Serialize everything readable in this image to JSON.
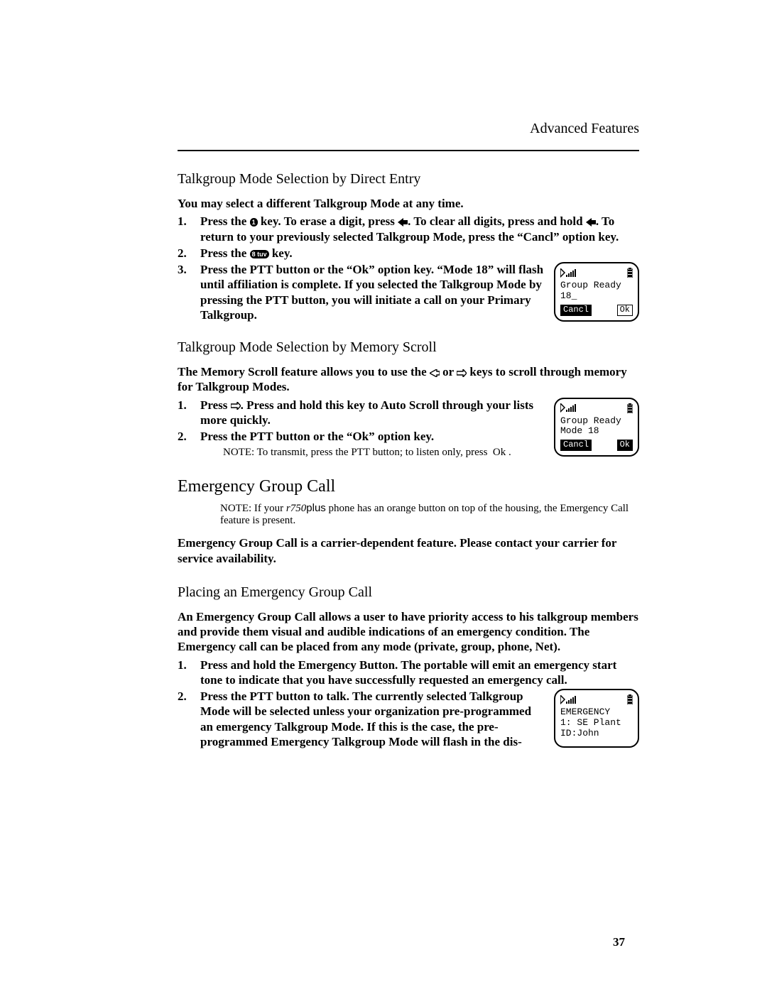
{
  "header": {
    "title": "Advanced Features"
  },
  "s1": {
    "title": "Talkgroup Mode Selection by Direct Entry",
    "intro": "You may select a different Talkgroup Mode at any time.",
    "step1a": "Press the ",
    "step1b": " key. To erase a digit, press ",
    "step1c": ". To clear all digits, press and hold ",
    "step1d": ". To return to your previously selected Talkgroup Mode, press the “Cancl” option key.",
    "step2a": "Press the ",
    "step2b": " key.",
    "step3": "Press the PTT button or the “Ok” option key. “Mode 18” will flash until affiliation is complete. If you selected the Talkgroup Mode by pressing the PTT button, you will initiate a call on your Primary Talkgroup.",
    "key1": "1",
    "key8": "8 tuv"
  },
  "screen1": {
    "line1": "Group Ready",
    "line2": "18_",
    "softL": "Cancl",
    "softR": "Ok"
  },
  "s2": {
    "title": "Talkgroup Mode Selection by Memory Scroll",
    "intro_a": "The Memory Scroll feature allows you to use the ",
    "intro_b": " or ",
    "intro_c": " keys to scroll through memory for Talkgroup Modes.",
    "step1a": "Press ",
    "step1b": ". Press and hold this key to Auto Scroll through your lists more quickly.",
    "step2": "Press the PTT button or the “Ok” option key.",
    "note_label": "NOTE:",
    "note_body": "To transmit, press the PTT button; to listen only, press  Ok ."
  },
  "screen2": {
    "line1": "Group Ready",
    "line2": "Mode 18",
    "softL": "Cancl",
    "softR": "Ok"
  },
  "s3": {
    "title": "Emergency Group Call",
    "note_label": "NOTE:",
    "note_a": "If your ",
    "note_model": "r750",
    "note_plus": "plus",
    "note_b": " phone has an orange button on top of the housing, the Emergency Call feature is present.",
    "para": "Emergency Group Call is a carrier-dependent feature. Please contact your carrier for service availability."
  },
  "s4": {
    "title": "Placing an Emergency Group Call",
    "intro": "An Emergency Group Call allows a user to have priority access to his talkgroup members and provide them visual and audible indications of an emergency condition. The Emergency call can be placed from any mode (private, group, phone, Net).",
    "step1": "Press and hold the Emergency Button. The portable will emit an emergency start tone to indicate that you have successfully requested an emergency call.",
    "step2": "Press the PTT button to talk. The currently selected Talkgroup Mode will be selected unless your organization pre-programmed an emergency Talkgroup Mode. If this is the case, the pre-programmed Emergency Talkgroup Mode will flash in the dis-"
  },
  "screen3": {
    "line1": "EMERGENCY",
    "line2": "1: SE Plant",
    "line3": "ID:John"
  },
  "page_number": "37"
}
